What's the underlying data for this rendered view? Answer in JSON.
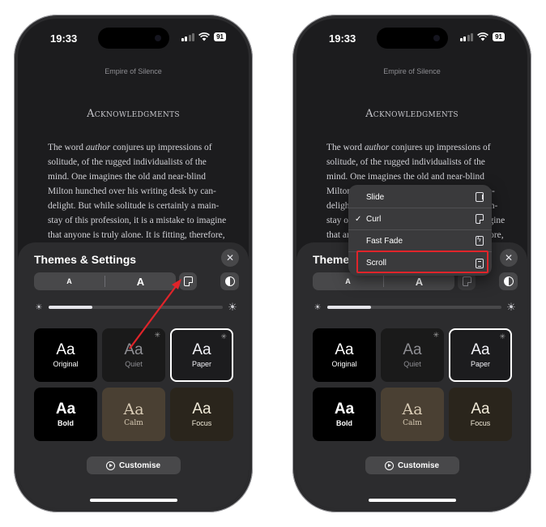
{
  "status": {
    "time": "19:33",
    "battery": "91"
  },
  "book": {
    "title": "Empire of Silence",
    "chapter": "Acknowledgments",
    "lines": [
      [
        "The word ",
        "author",
        " conjures up impressions of"
      ],
      [
        "solitude, of the rugged individualists of the"
      ],
      [
        "mind. One imagines the old and near-blind"
      ],
      [
        "Milton hunched over his writing desk by can-"
      ],
      [
        "delight. But while solitude is certainly a main-"
      ],
      [
        "stay of this profession, it is a mistake to imagine"
      ],
      [
        "that anyone is truly alone. It is fitting, therefore,"
      ]
    ]
  },
  "sheet": {
    "title": "Themes & Settings",
    "font_small": "A",
    "font_large": "A",
    "brightness_level": 0.25,
    "customise": "Customise"
  },
  "themes": [
    {
      "id": "original",
      "aa": "Aa",
      "name": "Original"
    },
    {
      "id": "quiet",
      "aa": "Aa",
      "name": "Quiet",
      "starred": true
    },
    {
      "id": "paper",
      "aa": "Aa",
      "name": "Paper",
      "starred": true,
      "selected": true
    },
    {
      "id": "bold",
      "aa": "Aa",
      "name": "Bold"
    },
    {
      "id": "calm",
      "aa": "Aa",
      "name": "Calm"
    },
    {
      "id": "focus",
      "aa": "Aa",
      "name": "Focus"
    }
  ],
  "menu": {
    "items": [
      {
        "label": "Slide",
        "icon": "slide-icon"
      },
      {
        "label": "Curl",
        "icon": "curl-icon",
        "checked": true
      },
      {
        "label": "Fast Fade",
        "icon": "fast-fade-icon"
      },
      {
        "label": "Scroll",
        "icon": "scroll-icon",
        "highlighted": true
      }
    ]
  },
  "colors": {
    "annotation": "#e0242a",
    "panel": "#2c2c2e"
  }
}
